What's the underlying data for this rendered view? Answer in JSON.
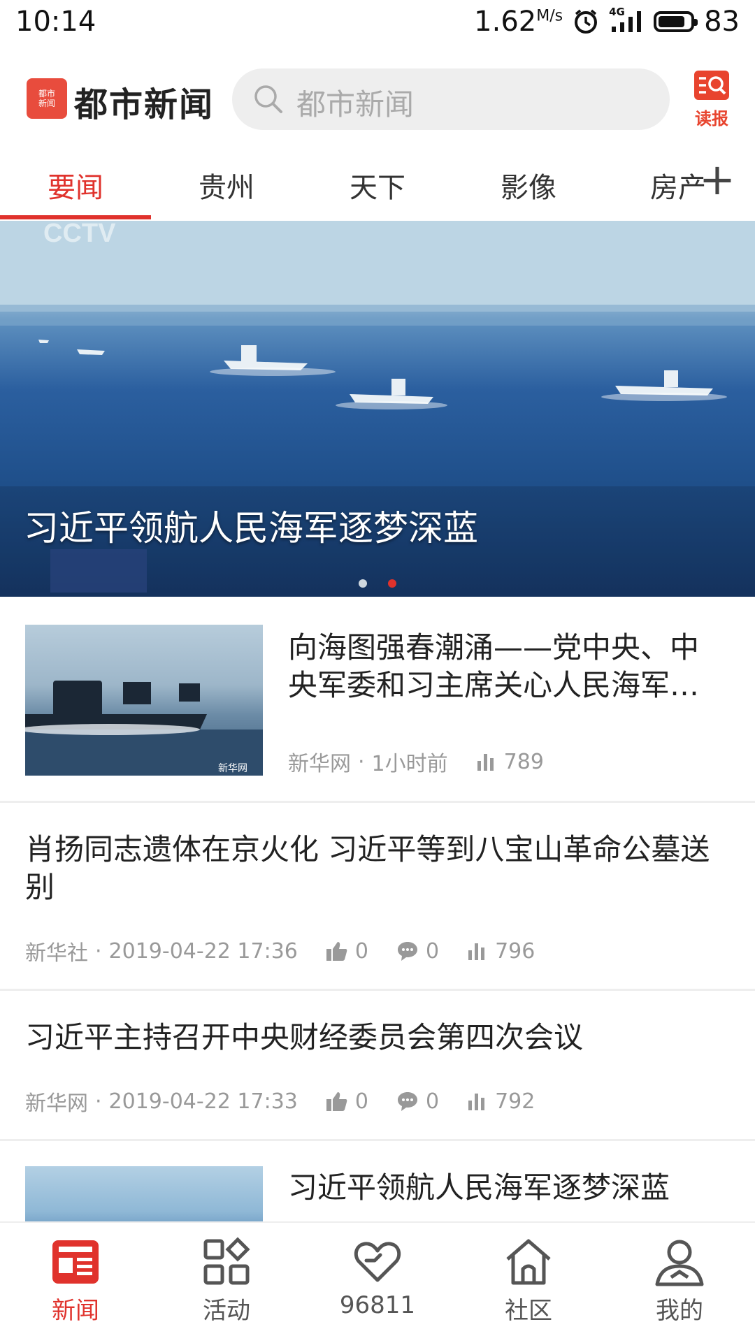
{
  "status_bar": {
    "time": "10:14",
    "speed": "1.62",
    "speed_unit": "M/s",
    "network": "4G",
    "battery": "83",
    "battery_level": 0.83
  },
  "header": {
    "logo_small": "都市新闻",
    "logo_text": "都市新闻",
    "search_placeholder": "都市新闻",
    "read_label": "读报"
  },
  "tabs": [
    {
      "label": "要闻",
      "active": true
    },
    {
      "label": "贵州"
    },
    {
      "label": "天下"
    },
    {
      "label": "影像"
    },
    {
      "label": "房产"
    }
  ],
  "hero": {
    "caption": "习近平领航人民海军逐梦深蓝",
    "watermark": "CCTV",
    "pages": 2,
    "active_page": 2
  },
  "news": [
    {
      "title": "向海图强春潮涌——党中央、中央军委和习主席关心人民海军…",
      "source": "新华网",
      "time": "1小时前",
      "views": "789",
      "thumb_watermark": "新华网"
    },
    {
      "title": "肖扬同志遗体在京火化 习近平等到八宝山革命公墓送别",
      "source": "新华社",
      "time": "2019-04-22 17:36",
      "likes": "0",
      "comments": "0",
      "views": "796"
    },
    {
      "title": "习近平主持召开中央财经委员会第四次会议",
      "source": "新华网",
      "time": "2019-04-22 17:33",
      "likes": "0",
      "comments": "0",
      "views": "792"
    },
    {
      "title": "习近平领航人民海军逐梦深蓝"
    }
  ],
  "bottom_nav": [
    {
      "label": "新闻",
      "icon": "newspaper-icon",
      "active": true
    },
    {
      "label": "活动",
      "icon": "grid-icon"
    },
    {
      "label": "96811",
      "icon": "heart-icon"
    },
    {
      "label": "社区",
      "icon": "home-icon"
    },
    {
      "label": "我的",
      "icon": "user-icon"
    }
  ],
  "colors": {
    "accent": "#e0322c",
    "logo": "#e84c3d",
    "text": "#222222",
    "meta": "#999999"
  }
}
